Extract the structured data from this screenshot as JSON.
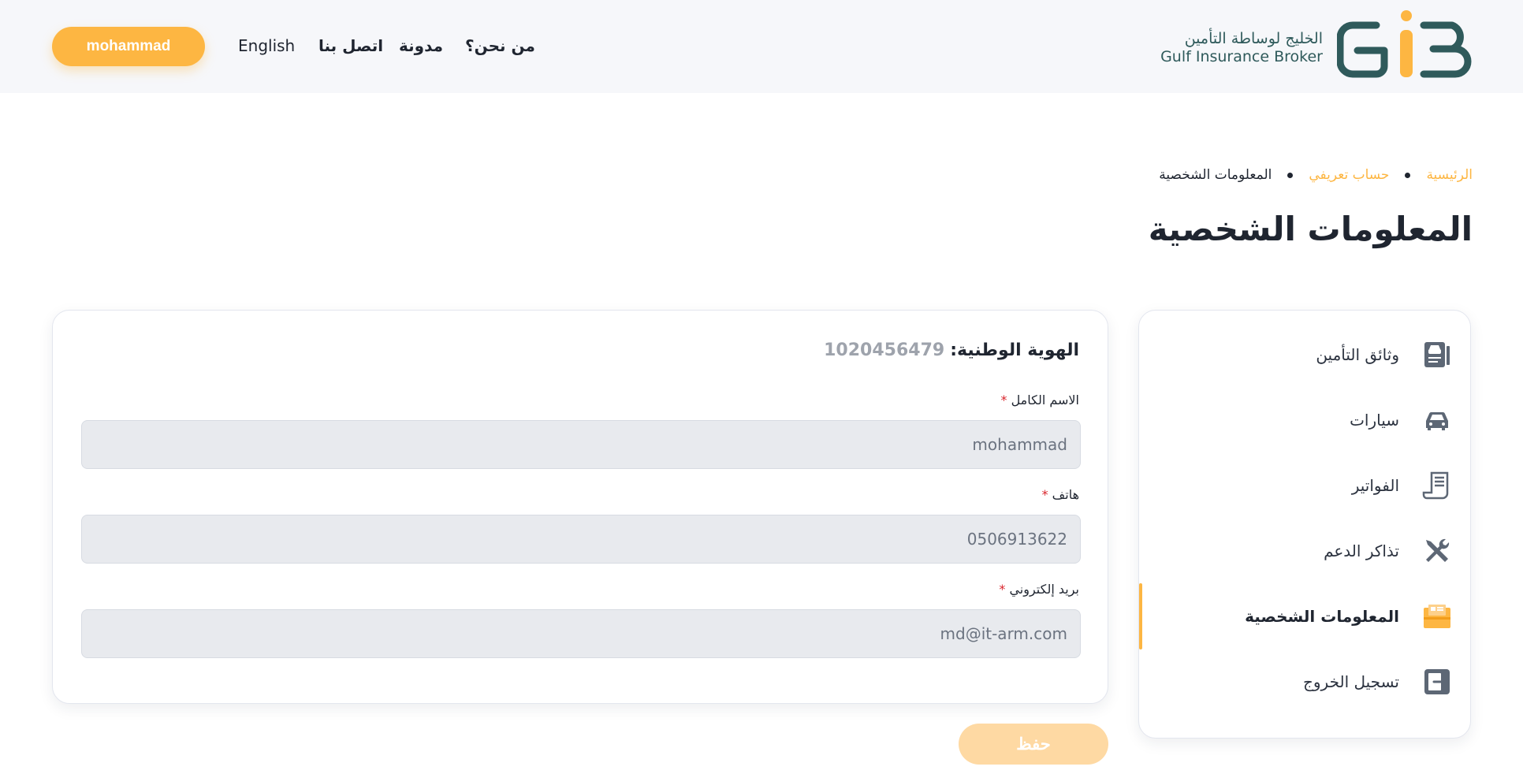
{
  "header": {
    "logo_ar": "الخليج لوساطة التأمين",
    "logo_en": "Gulf Insurance Broker",
    "nav": {
      "about": "من نحن؟",
      "blog": "مدونة",
      "contact": "اتصل بنا",
      "language": "English",
      "user": "mohammad"
    }
  },
  "breadcrumb": {
    "home": "الرئيسية",
    "account": "حساب تعريفي",
    "current": "المعلومات الشخصية"
  },
  "page_title": "المعلومات الشخصية",
  "sidebar": {
    "items": [
      {
        "label": "وثائق التأمين",
        "icon": "policy-document-icon"
      },
      {
        "label": "سيارات",
        "icon": "car-icon"
      },
      {
        "label": "الفواتير",
        "icon": "invoice-icon"
      },
      {
        "label": "تذاكر الدعم",
        "icon": "tools-icon"
      },
      {
        "label": "المعلومات الشخصية",
        "icon": "profile-card-icon",
        "active": true
      },
      {
        "label": "تسجيل الخروج",
        "icon": "logout-icon"
      }
    ]
  },
  "form": {
    "national_id_label": "الهوية الوطنية:",
    "national_id_value": "1020456479",
    "full_name_label": "الاسم الكامل",
    "full_name_value": "mohammad",
    "phone_label": "هاتف",
    "phone_value": "0506913622",
    "email_label": "بريد إلكتروني",
    "email_value": "md@it-arm.com",
    "required_mark": "*",
    "save_label": "حفظ"
  },
  "colors": {
    "accent": "#fdb642",
    "accent_disabled": "#fed9a3",
    "brand_teal": "#2f5a5b",
    "required": "#d9252c"
  }
}
